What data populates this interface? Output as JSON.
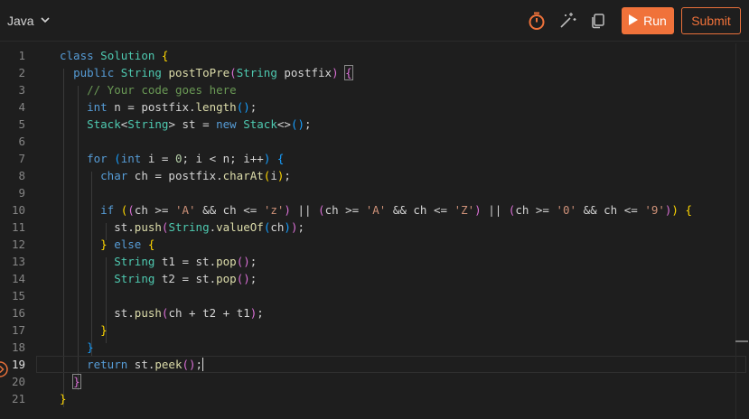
{
  "toolbar": {
    "language": "Java",
    "run_label": "Run",
    "submit_label": "Submit",
    "accent_color": "#f0723a"
  },
  "icons": [
    "chevron-down-icon",
    "timer-icon",
    "magic-wand-icon",
    "copy-icon",
    "play-icon",
    "debug-arrow-icon"
  ],
  "editor": {
    "active_line": "19",
    "lines": [
      {
        "n": "1",
        "text": "class Solution {"
      },
      {
        "n": "2",
        "text": "  public String postToPre(String postfix) {"
      },
      {
        "n": "3",
        "text": "    // Your code goes here"
      },
      {
        "n": "4",
        "text": "    int n = postfix.length();"
      },
      {
        "n": "5",
        "text": "    Stack<String> st = new Stack<>();"
      },
      {
        "n": "6",
        "text": ""
      },
      {
        "n": "7",
        "text": "    for (int i = 0; i < n; i++) {"
      },
      {
        "n": "8",
        "text": "      char ch = postfix.charAt(i);"
      },
      {
        "n": "9",
        "text": ""
      },
      {
        "n": "10",
        "text": "      if ((ch >= 'A' && ch <= 'z') || (ch >= 'A' && ch <= 'Z') || (ch >= '0' && ch <= '9')) {"
      },
      {
        "n": "11",
        "text": "        st.push(String.valueOf(ch));"
      },
      {
        "n": "12",
        "text": "      } else {"
      },
      {
        "n": "13",
        "text": "        String t1 = st.pop();"
      },
      {
        "n": "14",
        "text": "        String t2 = st.pop();"
      },
      {
        "n": "15",
        "text": ""
      },
      {
        "n": "16",
        "text": "        st.push(ch + t2 + t1);"
      },
      {
        "n": "17",
        "text": "      }"
      },
      {
        "n": "18",
        "text": "    }"
      },
      {
        "n": "19",
        "text": "    return st.peek();"
      },
      {
        "n": "20",
        "text": "  }"
      },
      {
        "n": "21",
        "text": "}"
      }
    ]
  }
}
